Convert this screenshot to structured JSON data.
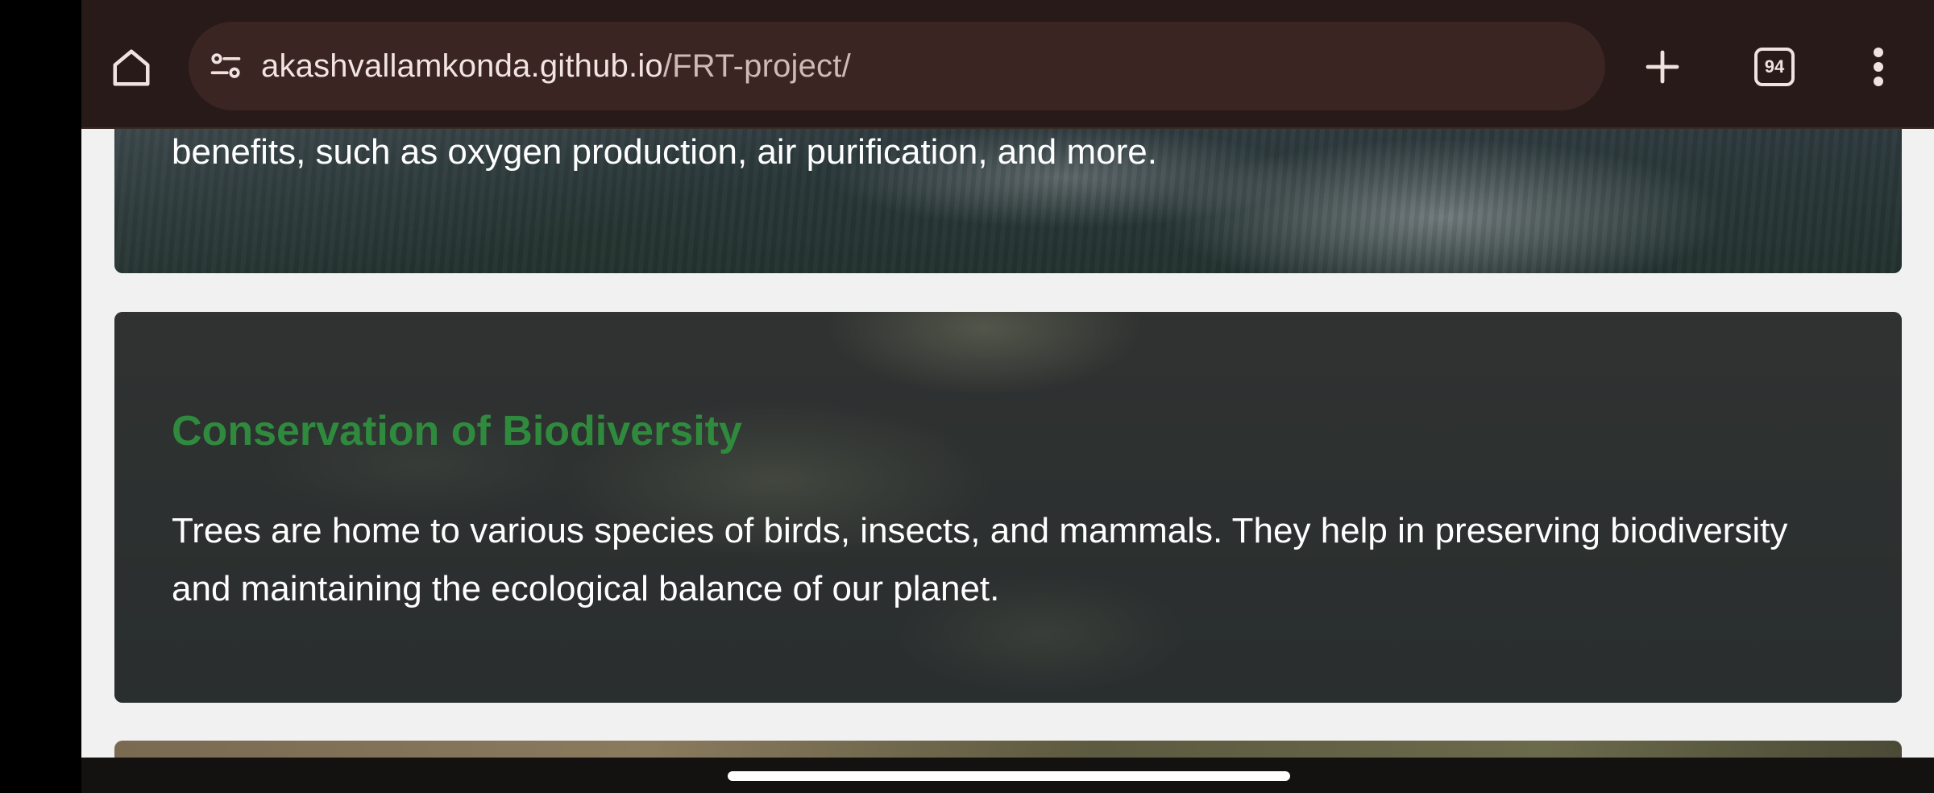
{
  "browser": {
    "url_host": "akashvallamkonda.github.io",
    "url_path": "/FRT-project/",
    "tab_count": "94",
    "icons": {
      "home": "home-icon",
      "site_info": "site-info-icon",
      "new_tab": "plus-icon",
      "tabs": "tab-switcher-icon",
      "menu": "more-vert-icon"
    }
  },
  "page": {
    "previous_card_text": "benefits, such as oxygen production, air purification, and more.",
    "card": {
      "title": "Conservation of Biodiversity",
      "body": "Trees are home to various species of birds, insects, and mammals. They help in preserving biodiversity and maintaining the ecological balance of our planet."
    }
  },
  "colors": {
    "toolbar_bg": "#271a18",
    "urlbar_bg": "#3b2523",
    "card_title": "#2f8a3e",
    "page_bg": "#f1f1f1"
  }
}
